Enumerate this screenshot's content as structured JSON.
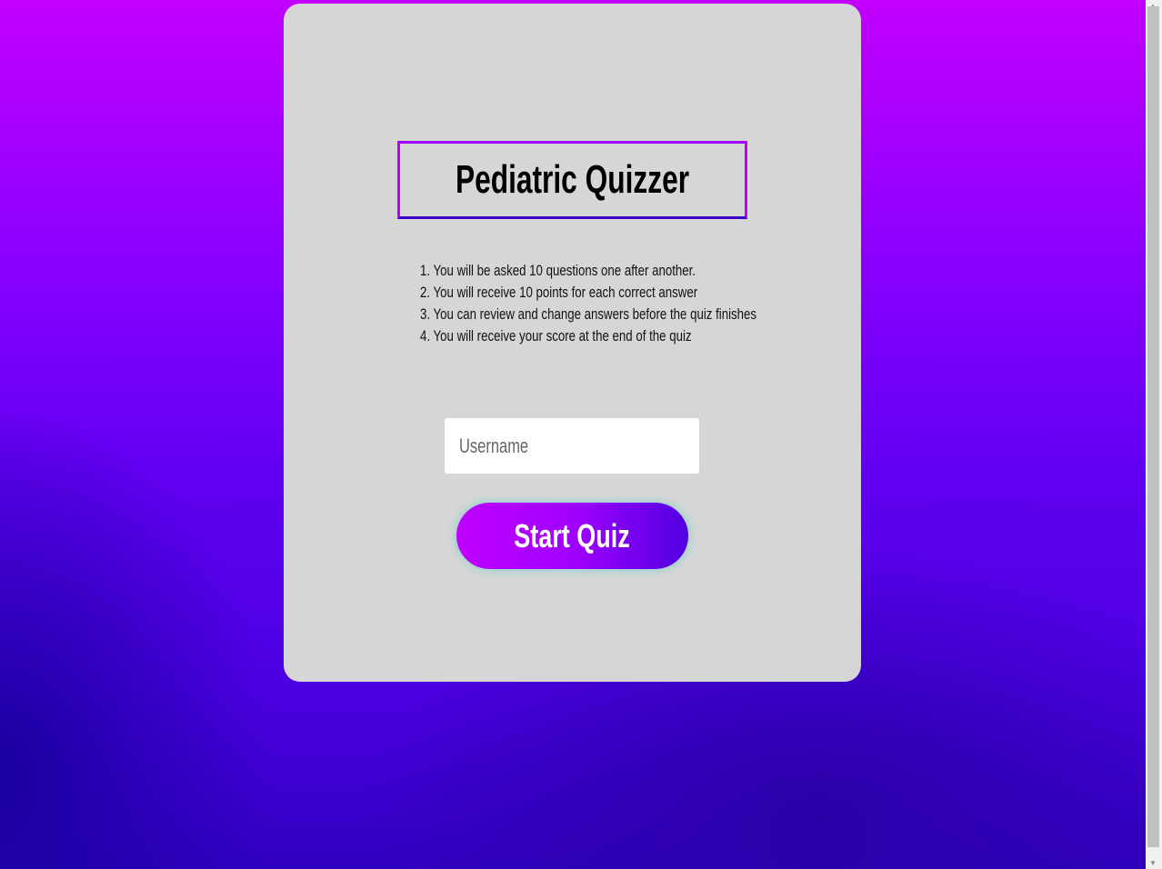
{
  "title": "Pediatric Quizzer",
  "rules": [
    "1. You will be asked 10 questions one after another.",
    "2. You will receive 10 points for each correct answer",
    "3. You can review and change answers before the quiz finishes",
    "4. You will receive your score at the end of the quiz"
  ],
  "username": {
    "placeholder": "Username",
    "value": ""
  },
  "start_label": "Start Quiz"
}
